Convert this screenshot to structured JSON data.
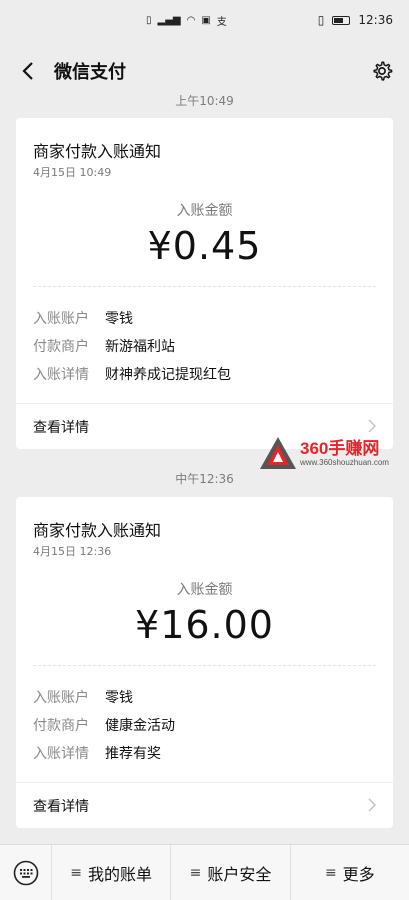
{
  "status_bar": {
    "left_icons": [
      "sim-icon",
      "signal-icon",
      "wifi-icon",
      "app-icon",
      "alipay-icon"
    ],
    "time": "12:36"
  },
  "header": {
    "title": "微信支付"
  },
  "timestamps": [
    "上午10:49",
    "中午12:36"
  ],
  "cards": [
    {
      "title": "商家付款入账通知",
      "date": "4月15日 10:49",
      "amount_label": "入账金额",
      "amount": "¥0.45",
      "rows": [
        {
          "key": "入账账户",
          "value": "零钱"
        },
        {
          "key": "付款商户",
          "value": "新游福利站"
        },
        {
          "key": "入账详情",
          "value": "财神养成记提现红包"
        }
      ],
      "link": "查看详情"
    },
    {
      "title": "商家付款入账通知",
      "date": "4月15日 12:36",
      "amount_label": "入账金额",
      "amount": "¥16.00",
      "rows": [
        {
          "key": "入账账户",
          "value": "零钱"
        },
        {
          "key": "付款商户",
          "value": "健康金活动"
        },
        {
          "key": "入账详情",
          "value": "推荐有奖"
        }
      ],
      "link": "查看详情"
    }
  ],
  "watermark": {
    "main": "360手赚网",
    "sub": "www.360shouzhuan.com"
  },
  "bottom_menu": [
    "我的账单",
    "账户安全",
    "更多"
  ],
  "colors": {
    "background": "#ededed",
    "card": "#ffffff",
    "watermark_red": "#e8232a"
  }
}
